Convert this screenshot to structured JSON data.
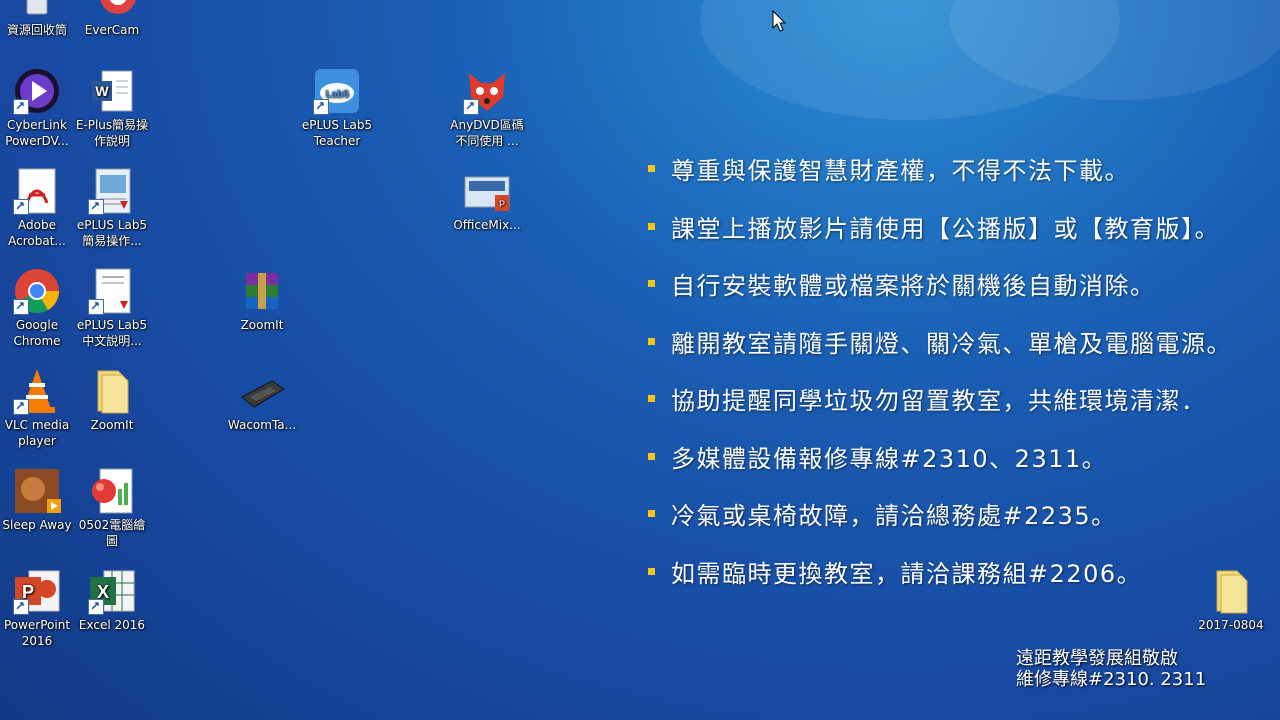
{
  "desktop": {
    "icons": [
      {
        "name": "recycle-bin-icon",
        "label": "資源回收筒",
        "shortcut": false
      },
      {
        "name": "evercam-icon",
        "label": "EverCam",
        "shortcut": false
      },
      {
        "name": "cyberlink-powerdvd-icon",
        "label": "CyberLink\nPowerDV...",
        "shortcut": true
      },
      {
        "name": "word-document-icon",
        "label": "E-Plus簡易操\n作說明",
        "shortcut": false
      },
      {
        "name": "eplus-lab5-teacher-icon",
        "label": "ePLUS Lab5\nTeacher",
        "shortcut": true
      },
      {
        "name": "anydvd-icon",
        "label": "AnyDVD區碼\n不同使用 ...",
        "shortcut": true
      },
      {
        "name": "adobe-acrobat-icon",
        "label": "Adobe\nAcrobat...",
        "shortcut": true
      },
      {
        "name": "pdf-document-icon",
        "label": "ePLUS Lab5\n簡易操作...",
        "shortcut": true
      },
      {
        "name": "officemix-icon",
        "label": "OfficeMix...",
        "shortcut": false
      },
      {
        "name": "google-chrome-icon",
        "label": "Google\nChrome",
        "shortcut": true
      },
      {
        "name": "pdf-document-icon",
        "label": "ePLUS Lab5\n中文說明...",
        "shortcut": true
      },
      {
        "name": "winrar-archive-icon",
        "label": "ZoomIt",
        "shortcut": false
      },
      {
        "name": "vlc-player-icon",
        "label": "VLC media\nplayer",
        "shortcut": true
      },
      {
        "name": "folder-icon",
        "label": "ZoomIt",
        "shortcut": false
      },
      {
        "name": "wacom-tablet-icon",
        "label": "WacomTa...",
        "shortcut": false
      },
      {
        "name": "video-file-icon",
        "label": "Sleep Away",
        "shortcut": false
      },
      {
        "name": "presentation-file-icon",
        "label": "0502電腦繪\n圖",
        "shortcut": false
      },
      {
        "name": "powerpoint-icon",
        "label": "PowerPoint\n2016",
        "shortcut": true
      },
      {
        "name": "excel-icon",
        "label": "Excel 2016",
        "shortcut": true
      },
      {
        "name": "folder-icon",
        "label": "2017-0804",
        "shortcut": false
      }
    ]
  },
  "wallpaper": {
    "rules": [
      "尊重與保護智慧財產權，不得不法下載。",
      "課堂上播放影片請使用【公播版】或【教育版】。",
      "自行安裝軟體或檔案將於關機後自動消除。",
      "離開教室請隨手關燈、關冷氣、單槍及電腦電源。",
      "協助提醒同學垃圾勿留置教室，共維環境清潔．",
      "多媒體設備報修專線#2310、2311。",
      "冷氣或桌椅故障，請洽總務處#2235。",
      "如需臨時更換教室，請洽課務組#2206。"
    ],
    "footer_line1": "遠距教學發展組敬啟",
    "footer_line2": "維修專線#2310. 2311"
  },
  "colors": {
    "bullet": "#f5c518",
    "background": "#1a5fb4"
  }
}
